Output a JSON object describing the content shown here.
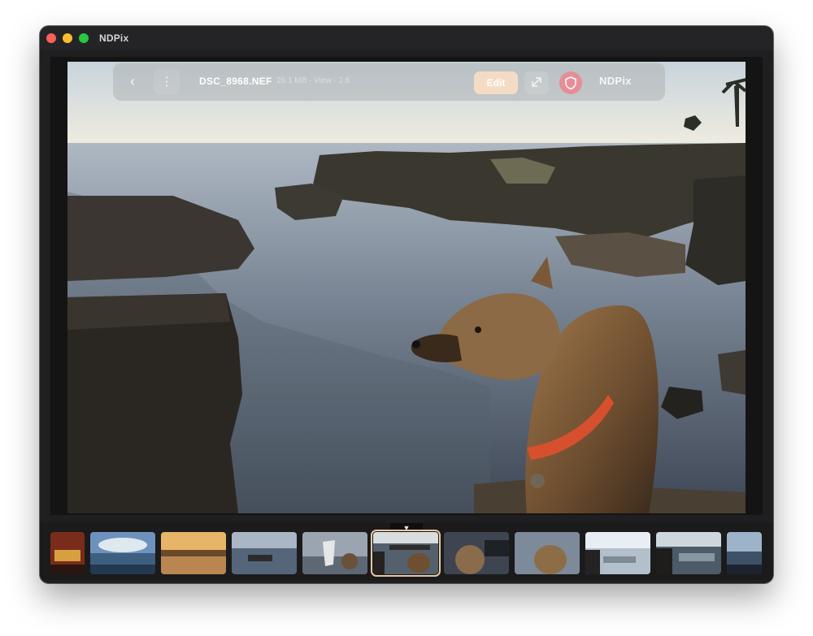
{
  "window": {
    "title": "NDPix"
  },
  "toolbar": {
    "back_icon": "chevron-left-icon",
    "more_icon": "vertical-ellipsis-icon",
    "filename": "DSC_8968.NEF",
    "meta": "26.1 MB · View · 2.6",
    "edit_label": "Edit",
    "expand_icon": "expand-arrows-icon",
    "shield_icon": "shield-icon",
    "brand": "NDPix",
    "accent": "#f4dcc4"
  },
  "filmstrip": {
    "handle_icon": "down-triangle-icon",
    "selected_index": 5,
    "thumbnails": [
      {
        "name": "thumb-1",
        "tone": "#7a2c1a"
      },
      {
        "name": "thumb-2",
        "tone": "#5a7da8"
      },
      {
        "name": "thumb-3",
        "tone": "#c89454"
      },
      {
        "name": "thumb-4",
        "tone": "#6f7f92"
      },
      {
        "name": "thumb-5",
        "tone": "#a9b1ba"
      },
      {
        "name": "thumb-6",
        "tone": "#3e4a57"
      },
      {
        "name": "thumb-7",
        "tone": "#4f5660"
      },
      {
        "name": "thumb-8",
        "tone": "#8a98a8"
      },
      {
        "name": "thumb-9",
        "tone": "#c1ccd6"
      },
      {
        "name": "thumb-10",
        "tone": "#5d6c7a"
      },
      {
        "name": "thumb-11",
        "tone": "#6d84a0"
      }
    ]
  }
}
